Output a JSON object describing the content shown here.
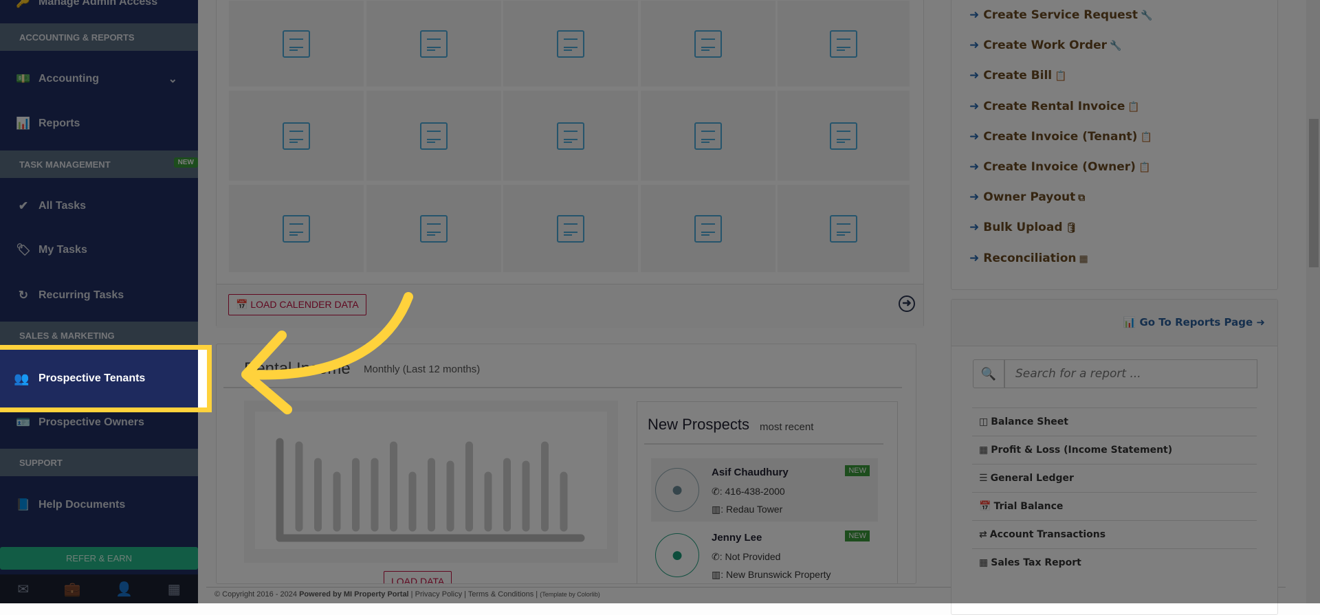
{
  "sidebar": {
    "partial_top": "Manage Admin Access",
    "sections": {
      "accounting": "ACCOUNTING & REPORTS",
      "tasks": "TASK MANAGEMENT",
      "tasks_badge": "NEW",
      "sales": "SALES & MARKETING",
      "support": "SUPPORT"
    },
    "items": {
      "accounting": "Accounting",
      "reports": "Reports",
      "all_tasks": "All Tasks",
      "my_tasks": "My Tasks",
      "recurring": "Recurring Tasks",
      "prospective_tenants": "Prospective Tenants",
      "prospective_owners": "Prospective Owners",
      "help": "Help Documents"
    },
    "refer": "REFER & EARN"
  },
  "calendar": {
    "load_button": "LOAD CALENDER DATA"
  },
  "rental_income": {
    "title": "Rental Income",
    "subtitle": "Monthly (Last 12 months)",
    "load_button": "LOAD DATA"
  },
  "prospects": {
    "title": "New Prospects",
    "subtitle": "most recent",
    "items": [
      {
        "name": "Asif Chaudhury",
        "phone": "416-438-2000",
        "property": "Redau Tower",
        "badge": "NEW"
      },
      {
        "name": "Jenny Lee",
        "phone": "Not Provided",
        "property": "New Brunswick Property",
        "badge": "NEW"
      }
    ]
  },
  "quick_links": [
    {
      "label": "Create Service Request",
      "icon": "wrench"
    },
    {
      "label": "Create Work Order",
      "icon": "wrench"
    },
    {
      "label": "Create Bill",
      "icon": "paste"
    },
    {
      "label": "Create Rental Invoice",
      "icon": "paste"
    },
    {
      "label": "Create Invoice (Tenant)",
      "icon": "paste"
    },
    {
      "label": "Create Invoice (Owner)",
      "icon": "paste"
    },
    {
      "label": "Owner Payout",
      "icon": "copy"
    },
    {
      "label": "Bulk Upload",
      "icon": "database"
    },
    {
      "label": "Reconciliation",
      "icon": "calculator"
    }
  ],
  "reports": {
    "go_link": "Go To Reports Page",
    "search_placeholder": "Search for a report ...",
    "items": [
      "Balance Sheet",
      "Profit & Loss (Income Statement)",
      "General Ledger",
      "Trial Balance",
      "Account Transactions",
      "Sales Tax Report"
    ]
  },
  "footer": {
    "copyright": "© Copyright 2016 - 2024",
    "powered": "Powered by MI Property Portal",
    "privacy": "Privacy Policy",
    "terms": "Terms & Conditions",
    "template": "(Template by Colorlib)"
  },
  "colors": {
    "highlight": "#ffd23c",
    "sidebar": "#202f62",
    "link_arrow": "#2a6ab0"
  }
}
